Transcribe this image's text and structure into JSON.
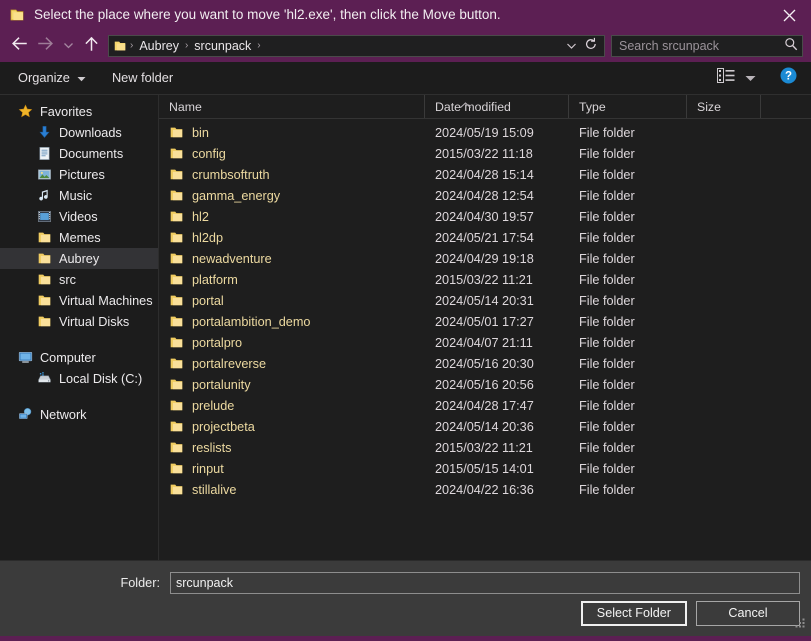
{
  "titlebar": {
    "text": "Select the place where you want to move 'hl2.exe', then click the Move button.",
    "icon": "folder-icon",
    "close_icon": "close-icon"
  },
  "nav": {
    "back_icon": "back-arrow-icon",
    "forward_icon": "forward-arrow-icon",
    "history_icon": "chevron-down-icon",
    "up_icon": "up-arrow-icon",
    "dropdown_icon": "chevron-down-icon",
    "refresh_icon": "refresh-icon",
    "breadcrumbs": [
      "Aubrey",
      "srcunpack"
    ],
    "separator": "›"
  },
  "search": {
    "placeholder": "Search srcunpack",
    "value": "",
    "icon": "search-icon"
  },
  "toolbar": {
    "organize_label": "Organize",
    "organize_caret": "caret-down-icon",
    "new_folder_label": "New folder",
    "view_icon": "view-list-icon",
    "view_caret_icon": "caret-down-icon",
    "help_icon": "help-icon",
    "help_glyph": "?"
  },
  "sidebar": {
    "groups": [
      {
        "header": {
          "label": "Favorites",
          "icon": "star-icon",
          "selected": false
        },
        "items": [
          {
            "label": "Downloads",
            "icon": "download-icon",
            "selected": false
          },
          {
            "label": "Documents",
            "icon": "documents-icon",
            "selected": false
          },
          {
            "label": "Pictures",
            "icon": "pictures-icon",
            "selected": false
          },
          {
            "label": "Music",
            "icon": "music-icon",
            "selected": false
          },
          {
            "label": "Videos",
            "icon": "videos-icon",
            "selected": false
          },
          {
            "label": "Memes",
            "icon": "folder-icon",
            "selected": false
          },
          {
            "label": "Aubrey",
            "icon": "folder-icon",
            "selected": true
          },
          {
            "label": "src",
            "icon": "folder-icon",
            "selected": false
          },
          {
            "label": "Virtual Machines",
            "icon": "folder-icon",
            "selected": false
          },
          {
            "label": "Virtual Disks",
            "icon": "folder-icon",
            "selected": false
          }
        ]
      },
      {
        "header": {
          "label": "Computer",
          "icon": "computer-icon",
          "selected": false
        },
        "items": [
          {
            "label": "Local Disk (C:)",
            "icon": "harddisk-icon",
            "selected": false
          }
        ]
      },
      {
        "header": {
          "label": "Network",
          "icon": "network-icon",
          "selected": false
        },
        "items": []
      }
    ]
  },
  "filelist": {
    "columns": [
      {
        "key": "name",
        "label": "Name",
        "sorted": "asc",
        "sort_icon": "caret-up-icon"
      },
      {
        "key": "date",
        "label": "Date modified",
        "sorted": ""
      },
      {
        "key": "type",
        "label": "Type",
        "sorted": ""
      },
      {
        "key": "size",
        "label": "Size",
        "sorted": ""
      }
    ],
    "rows": [
      {
        "icon": "folder-icon",
        "name": "bin",
        "date": "2024/05/19 15:09",
        "type": "File folder",
        "size": ""
      },
      {
        "icon": "folder-icon",
        "name": "config",
        "date": "2015/03/22 11:18",
        "type": "File folder",
        "size": ""
      },
      {
        "icon": "folder-icon",
        "name": "crumbsoftruth",
        "date": "2024/04/28 15:14",
        "type": "File folder",
        "size": ""
      },
      {
        "icon": "folder-icon",
        "name": "gamma_energy",
        "date": "2024/04/28 12:54",
        "type": "File folder",
        "size": ""
      },
      {
        "icon": "folder-icon",
        "name": "hl2",
        "date": "2024/04/30 19:57",
        "type": "File folder",
        "size": ""
      },
      {
        "icon": "folder-icon",
        "name": "hl2dp",
        "date": "2024/05/21 17:54",
        "type": "File folder",
        "size": ""
      },
      {
        "icon": "folder-icon",
        "name": "newadventure",
        "date": "2024/04/29 19:18",
        "type": "File folder",
        "size": ""
      },
      {
        "icon": "folder-icon",
        "name": "platform",
        "date": "2015/03/22 11:21",
        "type": "File folder",
        "size": ""
      },
      {
        "icon": "folder-icon",
        "name": "portal",
        "date": "2024/05/14 20:31",
        "type": "File folder",
        "size": ""
      },
      {
        "icon": "folder-icon",
        "name": "portalambition_demo",
        "date": "2024/05/01 17:27",
        "type": "File folder",
        "size": ""
      },
      {
        "icon": "folder-icon",
        "name": "portalpro",
        "date": "2024/04/07 21:11",
        "type": "File folder",
        "size": ""
      },
      {
        "icon": "folder-icon",
        "name": "portalreverse",
        "date": "2024/05/16 20:30",
        "type": "File folder",
        "size": ""
      },
      {
        "icon": "folder-icon",
        "name": "portalunity",
        "date": "2024/05/16 20:56",
        "type": "File folder",
        "size": ""
      },
      {
        "icon": "folder-icon",
        "name": "prelude",
        "date": "2024/04/28 17:47",
        "type": "File folder",
        "size": ""
      },
      {
        "icon": "folder-icon",
        "name": "projectbeta",
        "date": "2024/05/14 20:36",
        "type": "File folder",
        "size": ""
      },
      {
        "icon": "folder-icon",
        "name": "reslists",
        "date": "2015/03/22 11:21",
        "type": "File folder",
        "size": ""
      },
      {
        "icon": "folder-icon",
        "name": "rinput",
        "date": "2015/05/15 14:01",
        "type": "File folder",
        "size": ""
      },
      {
        "icon": "folder-icon",
        "name": "stillalive",
        "date": "2024/04/22 16:36",
        "type": "File folder",
        "size": ""
      }
    ]
  },
  "footer": {
    "folder_label": "Folder:",
    "folder_value": "srcunpack",
    "folder_placeholder": "",
    "select_button": "Select Folder",
    "cancel_button": "Cancel",
    "grip_icon": "resize-grip-icon"
  },
  "colors": {
    "titlebar": "#5c1f53",
    "chrome": "#1c1c1c",
    "list_bg": "#1e1e1e",
    "footer_bg": "#3b3b3b",
    "folder_yellow": "#f5d76e",
    "filename_text": "#ecd9a0",
    "selection": "#333336",
    "help_blue": "#1b8ad4"
  }
}
